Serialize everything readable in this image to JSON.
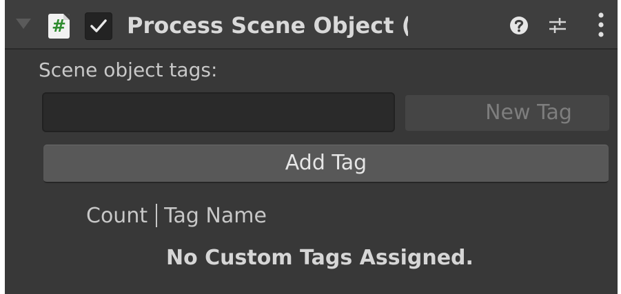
{
  "header": {
    "title": "Process Scene Object (Script",
    "enabled": true,
    "icons": [
      "foldout-arrow-icon",
      "script-icon",
      "checkbox-icon",
      "help-icon",
      "preset-icon",
      "kebab-menu-icon"
    ]
  },
  "tags": {
    "label": "Scene object tags:",
    "input_value": "",
    "new_tag_label": "New Tag",
    "add_tag_label": "Add Tag"
  },
  "table": {
    "columns": [
      "Count",
      "Tag Name"
    ],
    "empty_message": "No Custom Tags Assigned."
  },
  "colors": {
    "panel_bg": "#383838",
    "header_bg": "#3e3e3e",
    "script_hash": "#2e8b2e",
    "button_bg": "#585858"
  }
}
